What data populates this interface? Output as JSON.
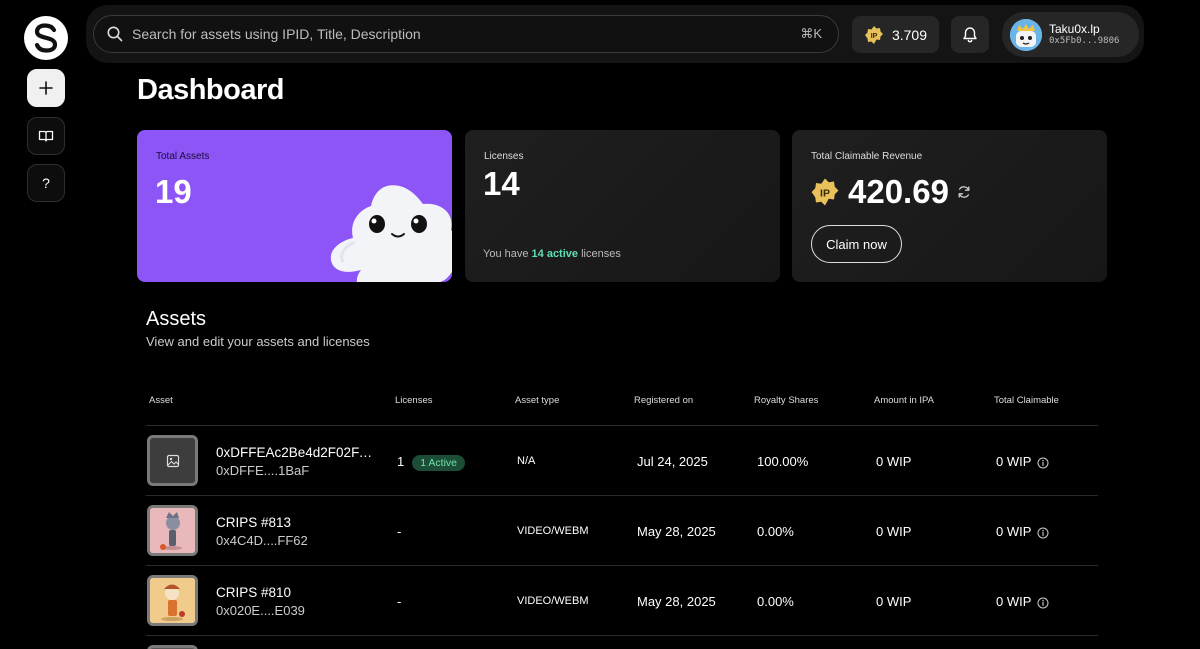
{
  "search": {
    "placeholder": "Search for assets using IPID, Title, Description",
    "shortcut": "⌘K"
  },
  "wallet": {
    "balance": "3.709",
    "token_symbol": "IP"
  },
  "user": {
    "name": "Taku0x.lp",
    "address": "0x5Fb0...9806"
  },
  "page": {
    "title": "Dashboard"
  },
  "cards": {
    "assets": {
      "label": "Total Assets",
      "value": "19"
    },
    "licenses": {
      "label": "Licenses",
      "value": "14",
      "footer_prefix": "You have ",
      "footer_highlight": "14 active",
      "footer_suffix": " licenses"
    },
    "revenue": {
      "label": "Total Claimable Revenue",
      "value": "420.69",
      "claim_label": "Claim now"
    }
  },
  "assets_section": {
    "title": "Assets",
    "subtitle": "View and edit your assets and licenses",
    "columns": {
      "asset": "Asset",
      "licenses": "Licenses",
      "type": "Asset type",
      "registered": "Registered on",
      "royalty": "Royalty Shares",
      "amount": "Amount in IPA",
      "claimable": "Total Claimable"
    },
    "rows": [
      {
        "name": "0xDFFEAc2Be4d2F02FA…",
        "id": "0xDFFE....1BaF",
        "licenses": "1",
        "badge": "1 Active",
        "type": "N/A",
        "registered": "Jul 24, 2025",
        "royalty": "100.00%",
        "amount": "0 WIP",
        "claimable": "0 WIP"
      },
      {
        "name": "CRIPS #813",
        "id": "0x4C4D....FF62",
        "licenses": "-",
        "badge": "",
        "type": "VIDEO/WEBM",
        "registered": "May 28, 2025",
        "royalty": "0.00%",
        "amount": "0 WIP",
        "claimable": "0 WIP"
      },
      {
        "name": "CRIPS #810",
        "id": "0x020E....E039",
        "licenses": "-",
        "badge": "",
        "type": "VIDEO/WEBM",
        "registered": "May 28, 2025",
        "royalty": "0.00%",
        "amount": "0 WIP",
        "claimable": "0 WIP"
      }
    ]
  },
  "colors": {
    "accent_purple": "#8d55f6",
    "active_green": "#5de0b4",
    "ip_gold": "#e8c15a"
  }
}
